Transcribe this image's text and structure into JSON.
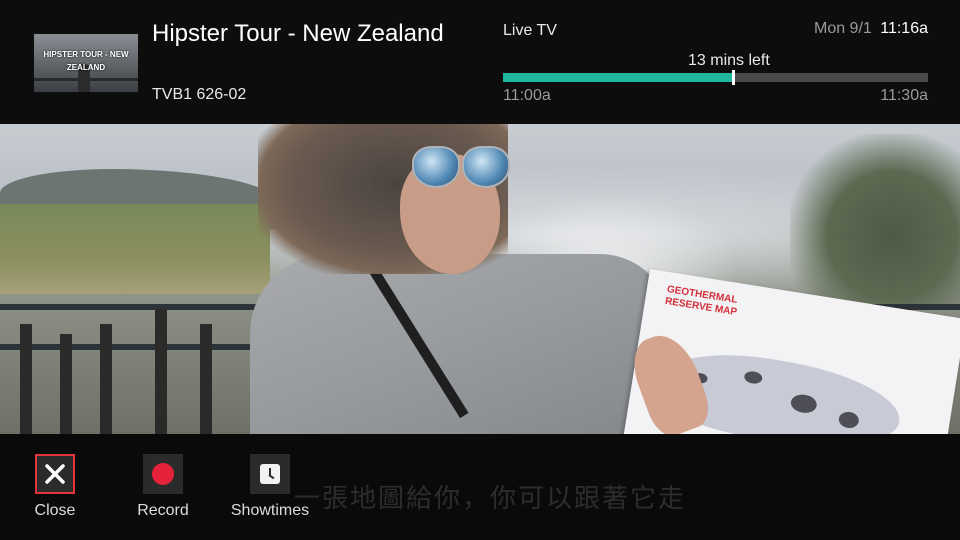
{
  "program": {
    "title": "Hipster Tour - New Zealand",
    "channel_info": "TVB1 626-02",
    "thumbnail_text": "HIPSTER TOUR - NEW ZEALAND"
  },
  "status": {
    "source_label": "Live TV",
    "date": "Mon 9/1",
    "time": "11:16a"
  },
  "progress": {
    "time_left": "13 mins left",
    "start_time": "11:00a",
    "end_time": "11:30a",
    "fraction_elapsed": 0.54,
    "fill_color": "#1fb89e"
  },
  "video": {
    "map_title": "GEOTHERMAL RESERVE MAP",
    "subtitle_text": "一張地圖給你，你可以跟著它走"
  },
  "actions": [
    {
      "label": "Close",
      "icon": "close-icon",
      "focused": true
    },
    {
      "label": "Record",
      "icon": "record-icon",
      "focused": false
    },
    {
      "label": "Showtimes",
      "icon": "clock-icon",
      "focused": false
    }
  ],
  "colors": {
    "focus_border": "#e3343e",
    "record_red": "#e6213a",
    "background": "#0d0d0d"
  }
}
